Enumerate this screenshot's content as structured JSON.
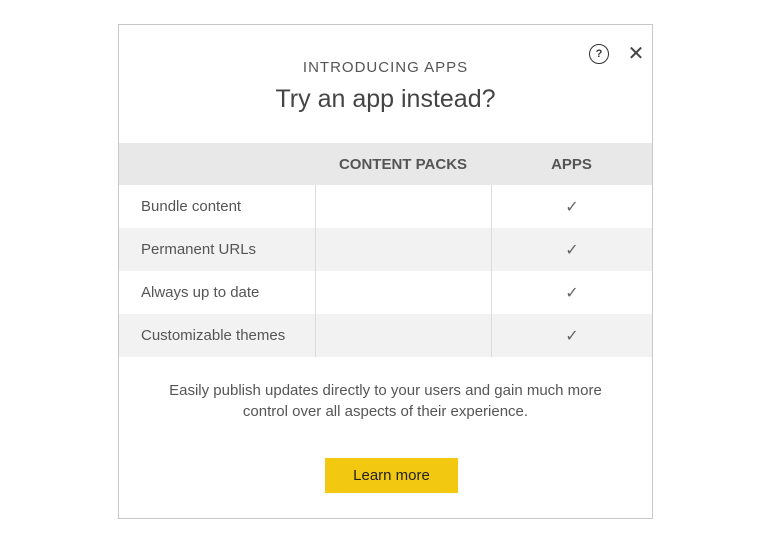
{
  "dialog": {
    "eyebrow": "INTRODUCING APPS",
    "title": "Try an app instead?",
    "help_icon": "help-circle-icon",
    "close_icon": "close-icon",
    "help_glyph": "?",
    "close_glyph": "✕"
  },
  "table": {
    "headers": [
      "",
      "CONTENT PACKS",
      "APPS"
    ],
    "rows": [
      {
        "label": "Bundle content",
        "content_packs": "",
        "apps": "✓"
      },
      {
        "label": "Permanent URLs",
        "content_packs": "",
        "apps": "✓"
      },
      {
        "label": "Always up to date",
        "content_packs": "",
        "apps": "✓"
      },
      {
        "label": "Customizable themes",
        "content_packs": "",
        "apps": "✓"
      }
    ]
  },
  "description": "Easily publish updates directly to your users and gain much more control over all aspects of their experience.",
  "learn_more_label": "Learn more",
  "colors": {
    "accent_button": "#f2c811",
    "header_row": "#e8e8e8",
    "shaded_row": "#f2f2f2"
  }
}
